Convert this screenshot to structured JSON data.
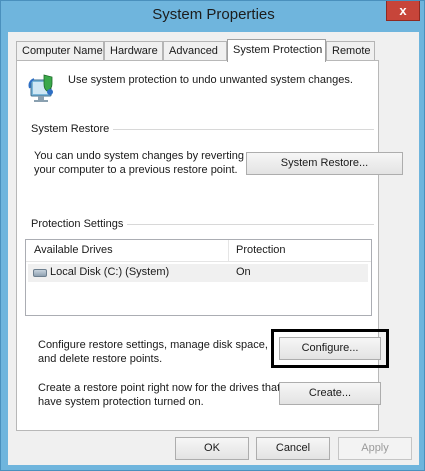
{
  "window": {
    "title": "System Properties",
    "close_glyph": "x"
  },
  "tabs": [
    {
      "label": "Computer Name"
    },
    {
      "label": "Hardware"
    },
    {
      "label": "Advanced"
    },
    {
      "label": "System Protection"
    },
    {
      "label": "Remote"
    }
  ],
  "active_tab": "System Protection",
  "intro": {
    "icon": "system-protection-icon",
    "text": "Use system protection to undo unwanted system changes."
  },
  "system_restore": {
    "group_label": "System Restore",
    "line1": "You can undo system changes by reverting",
    "line2": "your computer to a previous restore point.",
    "button_label": "System Restore..."
  },
  "protection_settings": {
    "group_label": "Protection Settings",
    "columns": [
      "Available Drives",
      "Protection"
    ],
    "rows": [
      {
        "icon": "local-disk-icon",
        "drive": "Local Disk (C:) (System)",
        "protection": "On"
      }
    ]
  },
  "configure": {
    "line1": "Configure restore settings, manage disk space,",
    "line2": "and delete restore points.",
    "button_label": "Configure..."
  },
  "create": {
    "line1": "Create a restore point right now for the drives that",
    "line2": "have system protection turned on.",
    "button_label": "Create..."
  },
  "footer": {
    "ok_label": "OK",
    "cancel_label": "Cancel",
    "apply_label": "Apply"
  }
}
